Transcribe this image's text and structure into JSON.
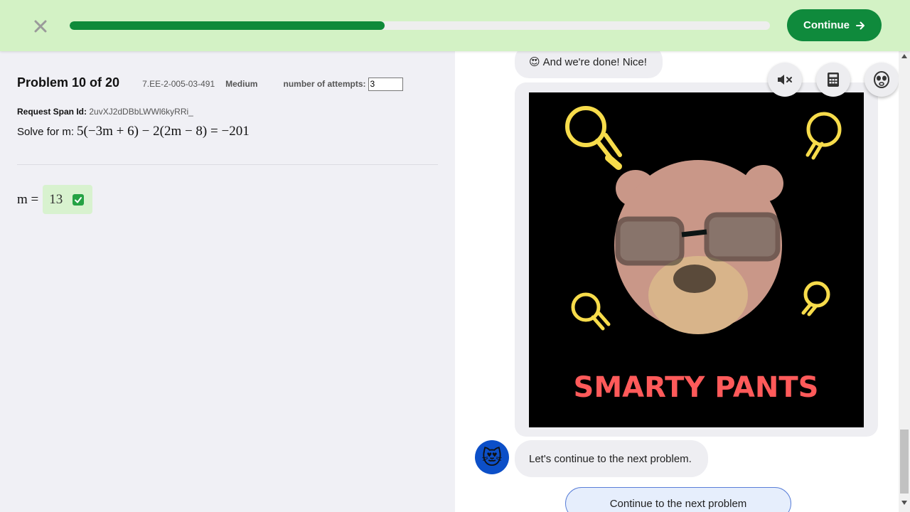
{
  "topbar": {
    "progress": 0.45,
    "continue_label": "Continue",
    "colors": {
      "bar_bg": "#d3f2c5",
      "accent": "#0f8a3c"
    }
  },
  "problem": {
    "title": "Problem 10 of 20",
    "code": "7.EE-2-005-03-491",
    "level": "Medium",
    "attempts_label": "number of attempts:",
    "attempts_value": "3",
    "span_label": "Request Span Id:",
    "span_value": "2uvXJ2dDBbLWWl6kyRRi_",
    "prompt": "Solve for m:",
    "equation": "5(−3m + 6) − 2(2m − 8) = −201",
    "answer_var": "m =",
    "answer_value": "13"
  },
  "chat": {
    "msg1_emoji": "😍",
    "msg1": "And we're done! Nice!",
    "image_caption": "SMARTY PANTS",
    "msg2": "Let's continue to the next problem.",
    "next_button": "Continue to the next problem",
    "avatar_emoji": "😻"
  },
  "tools": [
    "mute-icon",
    "calculator-icon",
    "alien-face-icon"
  ]
}
